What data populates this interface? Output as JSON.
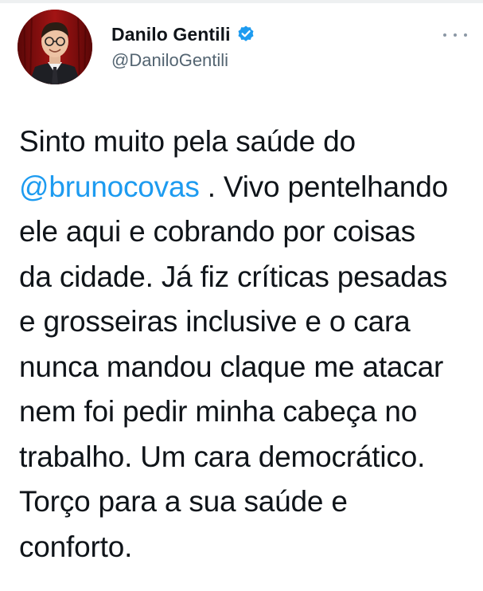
{
  "author": {
    "display_name": "Danilo Gentili",
    "handle": "@DaniloGentili",
    "verified": true,
    "avatar_icon": "profile-photo"
  },
  "menu": {
    "icon": "more-horizontal-icon"
  },
  "tweet": {
    "lines": [
      {
        "pre": "Sinto muito pela saúde do",
        "mention": "",
        "post": ""
      },
      {
        "pre": "",
        "mention": "@brunocovas",
        "post": " . Vivo pentelhando"
      },
      {
        "pre": "ele aqui e cobrando por coisas",
        "mention": "",
        "post": ""
      },
      {
        "pre": "da cidade. Já fiz críticas pesadas",
        "mention": "",
        "post": ""
      },
      {
        "pre": "e grosseiras inclusive e o cara",
        "mention": "",
        "post": ""
      },
      {
        "pre": "nunca mandou claque me atacar",
        "mention": "",
        "post": ""
      },
      {
        "pre": "nem foi pedir minha cabeça no",
        "mention": "",
        "post": ""
      },
      {
        "pre": "trabalho. Um cara democrático.",
        "mention": "",
        "post": ""
      },
      {
        "pre": "Torço para a sua saúde e",
        "mention": "",
        "post": ""
      },
      {
        "pre": "conforto.",
        "mention": "",
        "post": ""
      }
    ]
  },
  "colors": {
    "text": "#0f1419",
    "secondary": "#536471",
    "link": "#1d9bf0",
    "verified": "#1d9bf0"
  }
}
